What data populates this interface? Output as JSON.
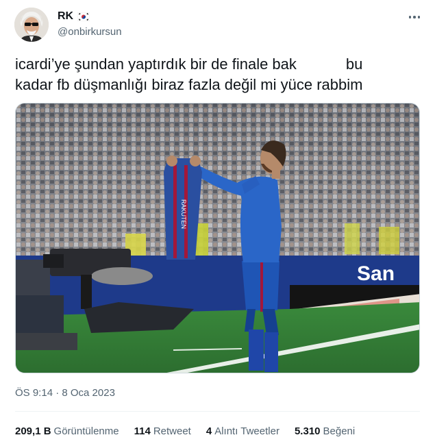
{
  "user": {
    "name": "RK",
    "handle": "@onbirkursun"
  },
  "tweet": {
    "line1": "icardi’ye şundan yaptırdık bir de finale bak",
    "line1_end": "bu",
    "line2": "kadar fb düşmanlığı biraz fazla değil mi yüce rabbim",
    "timestamp": "ÖS 9:14 · 8 Oca 2023"
  },
  "media": {
    "ad_board_text": "San",
    "shirt_text": "RAKUTEN"
  },
  "stats": {
    "views_count": "209,1 B",
    "views_label": "Görüntülenme",
    "retweets_count": "114",
    "retweets_label": "Retweet",
    "quotes_count": "4",
    "quotes_label": "Alıntı Tweetler",
    "likes_count": "5.310",
    "likes_label": "Beğeni"
  },
  "colors": {
    "text": "#0f1419",
    "secondary": "#536471",
    "divider": "#eff3f4",
    "pitch": "#2f7a34",
    "kit_blue": "#1f55b5",
    "kit_red": "#a3173a"
  },
  "icons": {
    "flag": "south-korea-flag-icon",
    "more": "more-dots-icon"
  }
}
